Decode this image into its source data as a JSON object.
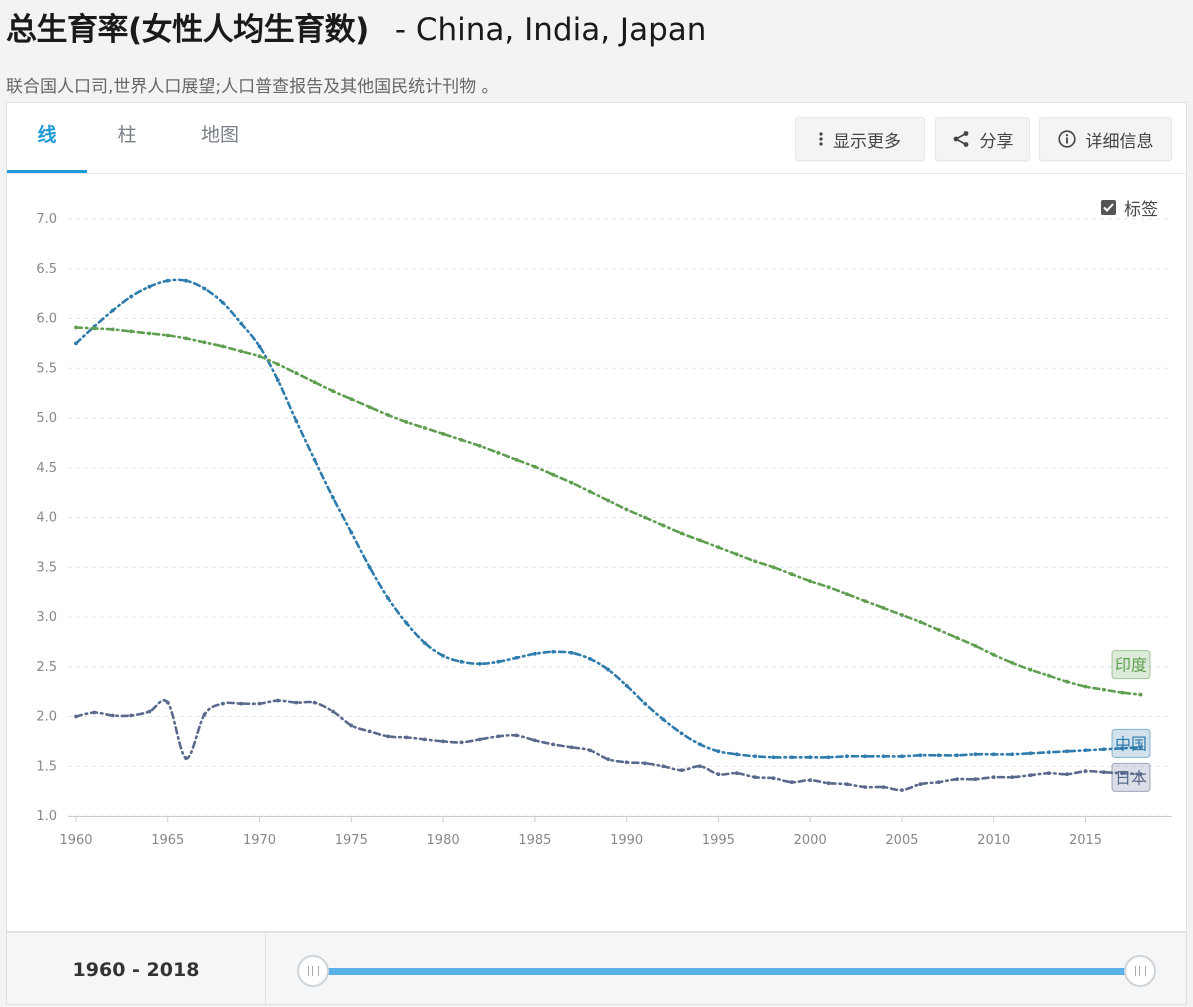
{
  "page": {
    "title": "总生育率(女性人均生育数)",
    "countries_title": "- China, India, Japan",
    "source": "联合国人口司,世界人口展望;人口普查报告及其他国民统计刊物 。"
  },
  "tabs": [
    {
      "label": "线",
      "active": true
    },
    {
      "label": "柱",
      "active": false
    },
    {
      "label": "地图",
      "active": false
    }
  ],
  "toolbar": {
    "more_label": "显示更多",
    "share_label": "分享",
    "info_label": "详细信息"
  },
  "labels_toggle": {
    "label": "标签",
    "checked": true
  },
  "footer": {
    "range_label": "1960 - 2018",
    "range_start": 1960,
    "range_end": 2018
  },
  "chart_data": {
    "type": "line",
    "title": "",
    "xlabel": "",
    "ylabel": "",
    "xlim": [
      1960,
      2018
    ],
    "ylim": [
      1.0,
      7.0
    ],
    "y_ticks": [
      "1.0",
      "1.5",
      "2.0",
      "2.5",
      "3.0",
      "3.5",
      "4.0",
      "4.5",
      "5.0",
      "5.5",
      "6.0",
      "6.5",
      "7.0"
    ],
    "x_ticks": [
      "1960",
      "1965",
      "1970",
      "1975",
      "1980",
      "1985",
      "1990",
      "1995",
      "2000",
      "2005",
      "2010",
      "2015"
    ],
    "grid": true,
    "legend": "end-labels",
    "x": [
      1960,
      1961,
      1962,
      1963,
      1964,
      1965,
      1966,
      1967,
      1968,
      1969,
      1970,
      1971,
      1972,
      1973,
      1974,
      1975,
      1976,
      1977,
      1978,
      1979,
      1980,
      1981,
      1982,
      1983,
      1984,
      1985,
      1986,
      1987,
      1988,
      1989,
      1990,
      1991,
      1992,
      1993,
      1994,
      1995,
      1996,
      1997,
      1998,
      1999,
      2000,
      2001,
      2002,
      2003,
      2004,
      2005,
      2006,
      2007,
      2008,
      2009,
      2010,
      2011,
      2012,
      2013,
      2014,
      2015,
      2016,
      2017,
      2018
    ],
    "series": [
      {
        "name": "中国",
        "color": "#2e7bad",
        "dash": "6,4,1.5,4",
        "values": [
          5.75,
          5.92,
          6.08,
          6.22,
          6.32,
          6.38,
          6.38,
          6.3,
          6.16,
          5.95,
          5.72,
          5.38,
          4.97,
          4.58,
          4.2,
          3.85,
          3.5,
          3.19,
          2.94,
          2.74,
          2.61,
          2.55,
          2.53,
          2.55,
          2.59,
          2.63,
          2.65,
          2.64,
          2.58,
          2.47,
          2.31,
          2.13,
          1.97,
          1.83,
          1.72,
          1.65,
          1.62,
          1.6,
          1.59,
          1.59,
          1.59,
          1.59,
          1.6,
          1.6,
          1.6,
          1.6,
          1.61,
          1.61,
          1.61,
          1.62,
          1.62,
          1.62,
          1.63,
          1.64,
          1.65,
          1.66,
          1.67,
          1.68,
          1.69
        ]
      },
      {
        "name": "印度",
        "color": "#5e9e50",
        "dash": "6,4,1.5,4",
        "values": [
          5.91,
          5.9,
          5.89,
          5.87,
          5.85,
          5.83,
          5.8,
          5.76,
          5.72,
          5.67,
          5.62,
          5.54,
          5.45,
          5.36,
          5.27,
          5.19,
          5.11,
          5.03,
          4.96,
          4.9,
          4.84,
          4.78,
          4.72,
          4.65,
          4.58,
          4.51,
          4.43,
          4.35,
          4.26,
          4.17,
          4.08,
          4.0,
          3.92,
          3.84,
          3.77,
          3.7,
          3.63,
          3.56,
          3.5,
          3.43,
          3.36,
          3.3,
          3.23,
          3.16,
          3.09,
          3.02,
          2.95,
          2.87,
          2.79,
          2.71,
          2.62,
          2.54,
          2.47,
          2.41,
          2.35,
          2.3,
          2.27,
          2.24,
          2.22
        ]
      },
      {
        "name": "日本",
        "color": "#5a6a8c",
        "dash": "6,4,1.5,4",
        "values": [
          2.0,
          2.04,
          2.01,
          2.01,
          2.05,
          2.14,
          1.58,
          2.02,
          2.13,
          2.13,
          2.13,
          2.16,
          2.14,
          2.14,
          2.05,
          1.91,
          1.85,
          1.8,
          1.79,
          1.77,
          1.75,
          1.74,
          1.77,
          1.8,
          1.81,
          1.76,
          1.72,
          1.69,
          1.66,
          1.57,
          1.54,
          1.53,
          1.5,
          1.46,
          1.5,
          1.42,
          1.43,
          1.39,
          1.38,
          1.34,
          1.36,
          1.33,
          1.32,
          1.29,
          1.29,
          1.26,
          1.32,
          1.34,
          1.37,
          1.37,
          1.39,
          1.39,
          1.41,
          1.43,
          1.42,
          1.45,
          1.44,
          1.43,
          1.42
        ]
      }
    ]
  }
}
